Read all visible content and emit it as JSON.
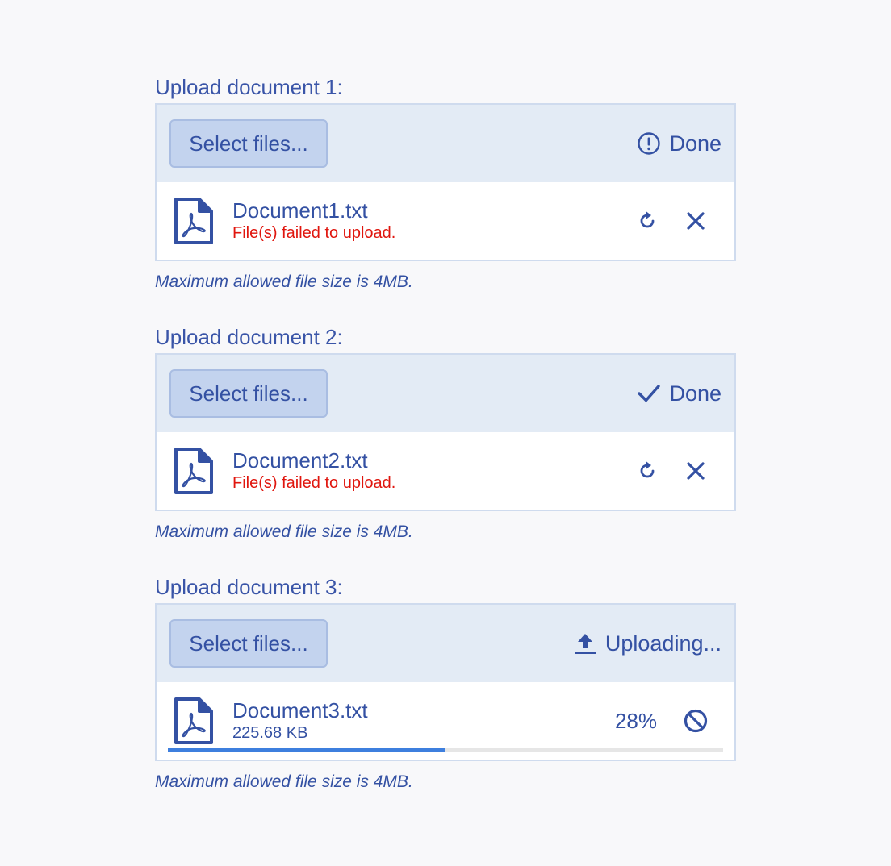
{
  "uploads": [
    {
      "label": "Upload document 1:",
      "select_label": "Select files...",
      "status_icon": "exclamation-circle-icon",
      "status_text": "Done",
      "file_name": "Document1.txt",
      "file_message": "File(s) failed to upload.",
      "hint": "Maximum allowed file size is 4MB."
    },
    {
      "label": "Upload document 2:",
      "select_label": "Select files...",
      "status_icon": "check-icon",
      "status_text": "Done",
      "file_name": "Document2.txt",
      "file_message": "File(s) failed to upload.",
      "hint": "Maximum allowed file size is 4MB."
    },
    {
      "label": "Upload document 3:",
      "select_label": "Select files...",
      "status_icon": "upload-icon",
      "status_text": "Uploading...",
      "file_name": "Document3.txt",
      "file_size": "225.68 KB",
      "percent": "28%",
      "progress": 0.5,
      "hint": "Maximum allowed file size is 4MB."
    }
  ],
  "colors": {
    "accent": "#3451a3",
    "error": "#e0160e",
    "progress": "#3e7fde",
    "toolbar_bg": "#e3ebf5",
    "button_bg": "#c3d3ee"
  }
}
